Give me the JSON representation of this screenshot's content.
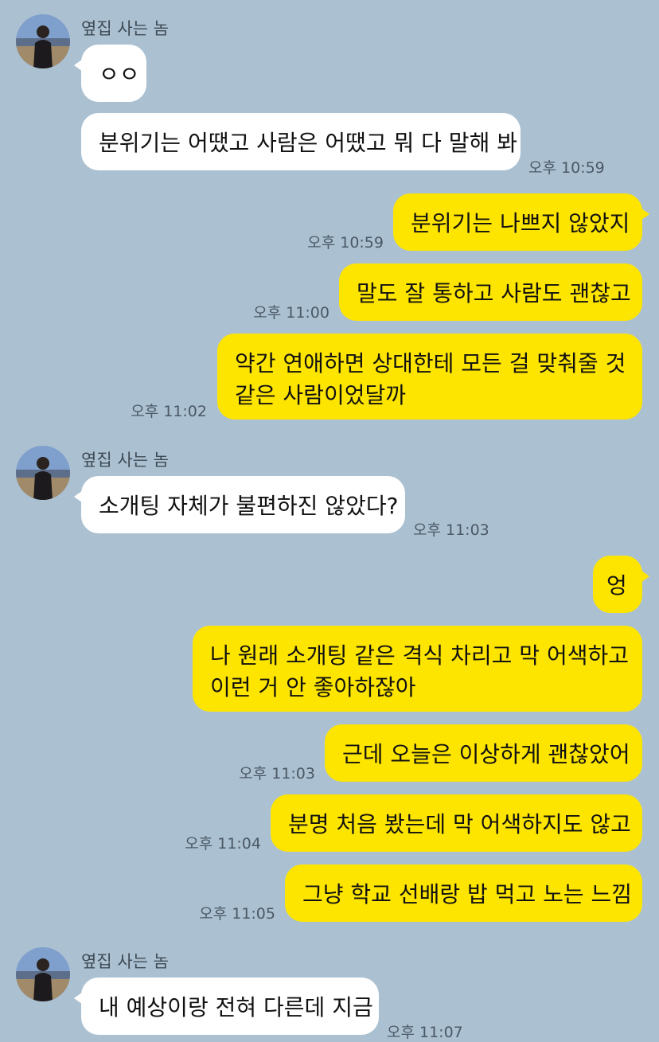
{
  "colors": {
    "background": "#abc1d1",
    "incoming_bubble": "#ffffff",
    "outgoing_bubble": "#fee500"
  },
  "contact": {
    "name": "옆집 사는 놈",
    "avatar_icon": "profile-photo-icon"
  },
  "messages": [
    {
      "dir": "in",
      "text": "ㅇㅇ",
      "time": ""
    },
    {
      "dir": "in",
      "text": "분위기는 어땠고 사람은 어땠고 뭐 다 말해 봐",
      "time": "오후 10:59"
    },
    {
      "dir": "out",
      "text": "분위기는 나쁘지 않았지",
      "time": "오후 10:59"
    },
    {
      "dir": "out",
      "text": "말도 잘 통하고 사람도 괜찮고",
      "time": "오후 11:00"
    },
    {
      "dir": "out",
      "text": [
        "약간 연애하면 상대한테 모든 걸 맞춰줄 것",
        "같은 사람이었달까"
      ],
      "time": "오후 11:02"
    },
    {
      "dir": "in",
      "text": "소개팅 자체가 불편하진 않았다?",
      "time": "오후 11:03"
    },
    {
      "dir": "out",
      "text": "엉",
      "time": ""
    },
    {
      "dir": "out",
      "text": [
        "나 원래 소개팅 같은 격식 차리고 막 어색하고",
        "이런 거 안 좋아하잖아"
      ],
      "time": ""
    },
    {
      "dir": "out",
      "text": "근데 오늘은 이상하게 괜찮았어",
      "time": "오후 11:03"
    },
    {
      "dir": "out",
      "text": "분명 처음 봤는데 막 어색하지도 않고",
      "time": "오후 11:04"
    },
    {
      "dir": "out",
      "text": "그냥 학교 선배랑 밥 먹고 노는 느낌",
      "time": "오후 11:05"
    },
    {
      "dir": "in",
      "text": "내 예상이랑 전혀 다른데 지금",
      "time": "오후 11:07"
    }
  ]
}
